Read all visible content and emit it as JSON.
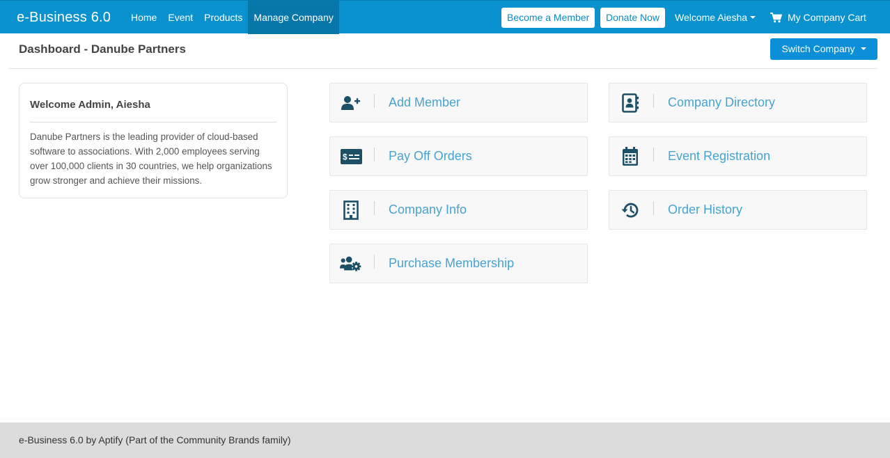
{
  "navbar": {
    "brand": "e-Business 6.0",
    "links": [
      {
        "label": "Home",
        "active": false
      },
      {
        "label": "Event",
        "active": false
      },
      {
        "label": "Products",
        "active": false
      },
      {
        "label": "Manage Company",
        "active": true
      }
    ],
    "become_member": "Become a Member",
    "donate": "Donate Now",
    "welcome": "Welcome Aiesha",
    "cart": "My Company Cart"
  },
  "header": {
    "title": "Dashboard - Danube Partners",
    "switch_company": "Switch Company"
  },
  "welcome_card": {
    "title": "Welcome Admin, Aiesha",
    "text": "Danube Partners is the leading provider of cloud-based software to associations. With 2,000 employees serving over 100,000 clients in 30 countries, we help organizations grow stronger and achieve their missions."
  },
  "tiles": [
    {
      "label": "Add Member",
      "icon": "add-user-icon"
    },
    {
      "label": "Company Directory",
      "icon": "address-book-icon"
    },
    {
      "label": "Pay Off Orders",
      "icon": "money-check-icon"
    },
    {
      "label": "Event Registration",
      "icon": "calendar-icon"
    },
    {
      "label": "Company Info",
      "icon": "building-icon"
    },
    {
      "label": "Order History",
      "icon": "history-icon"
    },
    {
      "label": "Purchase Membership",
      "icon": "users-cog-icon"
    }
  ],
  "footer": {
    "text": "e-Business 6.0 by Aptify (Part of the Community Brands family)"
  },
  "colors": {
    "navbar": "#0a92cf",
    "nav_active": "#0677a8",
    "primary_button": "#0a8fd8",
    "tile_label": "#47a3cf",
    "tile_icon": "#1d4f66",
    "footer": "#dcdcdc"
  }
}
